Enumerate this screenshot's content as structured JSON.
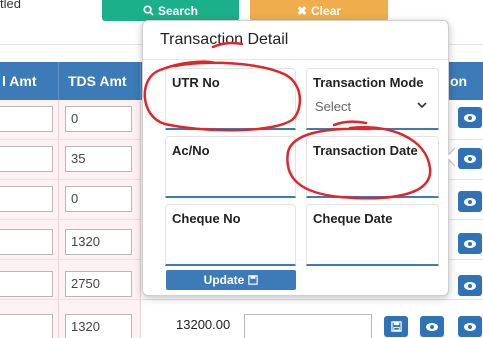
{
  "top": {
    "partial_text": "tled",
    "search_label": "Search",
    "clear_label": "Clear"
  },
  "table": {
    "headers": [
      "l Amt",
      "TDS Amt",
      "on"
    ],
    "tds_values": [
      "0",
      "35",
      "0",
      "1320",
      "2750",
      "1320"
    ],
    "amount_last": "13200.00"
  },
  "popup": {
    "title": "Transaction Detail",
    "fields": {
      "utr_label": "UTR No",
      "mode_label": "Transaction Mode",
      "mode_value": "Select",
      "acno_label": "Ac/No",
      "date_label": "Transaction Date",
      "cheque_no_label": "Cheque No",
      "cheque_date_label": "Cheque Date"
    },
    "update_label": "Update"
  },
  "colors": {
    "search": "#1cb08a",
    "clear": "#f0ad4e",
    "primary": "#3c7ab8",
    "annotation": "#e0262a"
  },
  "icons": [
    "search-icon",
    "close-icon",
    "save-icon",
    "eye-icon",
    "chevron-down-icon"
  ]
}
